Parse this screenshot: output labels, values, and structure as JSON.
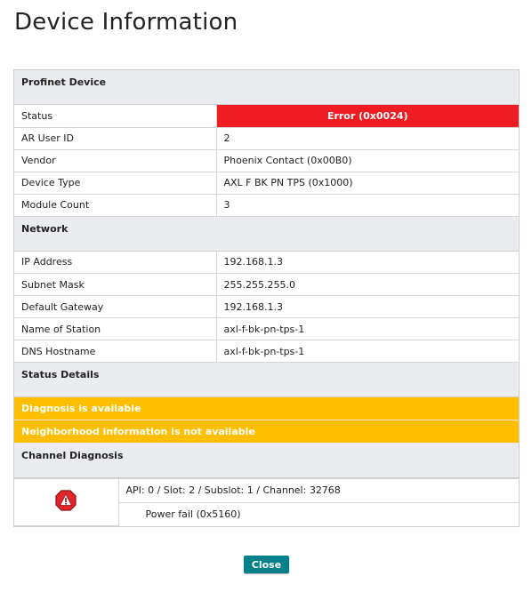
{
  "title": "Device Information",
  "profinet": {
    "header": "Profinet Device",
    "rows": [
      {
        "key": "Status",
        "value": "Error (0x0024)"
      },
      {
        "key": "AR User ID",
        "value": "2"
      },
      {
        "key": "Vendor",
        "value": "Phoenix Contact (0x00B0)"
      },
      {
        "key": "Device Type",
        "value": "AXL F BK PN TPS (0x1000)"
      },
      {
        "key": "Module Count",
        "value": "3"
      }
    ]
  },
  "network": {
    "header": "Network",
    "rows": [
      {
        "key": "IP Address",
        "value": "192.168.1.3"
      },
      {
        "key": "Subnet Mask",
        "value": "255.255.255.0"
      },
      {
        "key": "Default Gateway",
        "value": "192.168.1.3"
      },
      {
        "key": "Name of Station",
        "value": "axl-f-bk-pn-tps-1"
      },
      {
        "key": "DNS Hostname",
        "value": "axl-f-bk-pn-tps-1"
      }
    ]
  },
  "status_details": {
    "header": "Status Details",
    "messages": [
      "Diagnosis is available",
      "Neighborhood information is not available"
    ]
  },
  "channel_diagnosis": {
    "header": "Channel Diagnosis",
    "icon": "error-octagon-icon",
    "location": "API: 0 / Slot: 2 / Subslot: 1 / Channel: 32768",
    "message": "Power fail (0x5160)"
  },
  "close_label": "Close",
  "colors": {
    "error": "#ef1c24",
    "warning": "#ffbf00",
    "section_bg": "#eaecef",
    "button": "#00808a"
  }
}
